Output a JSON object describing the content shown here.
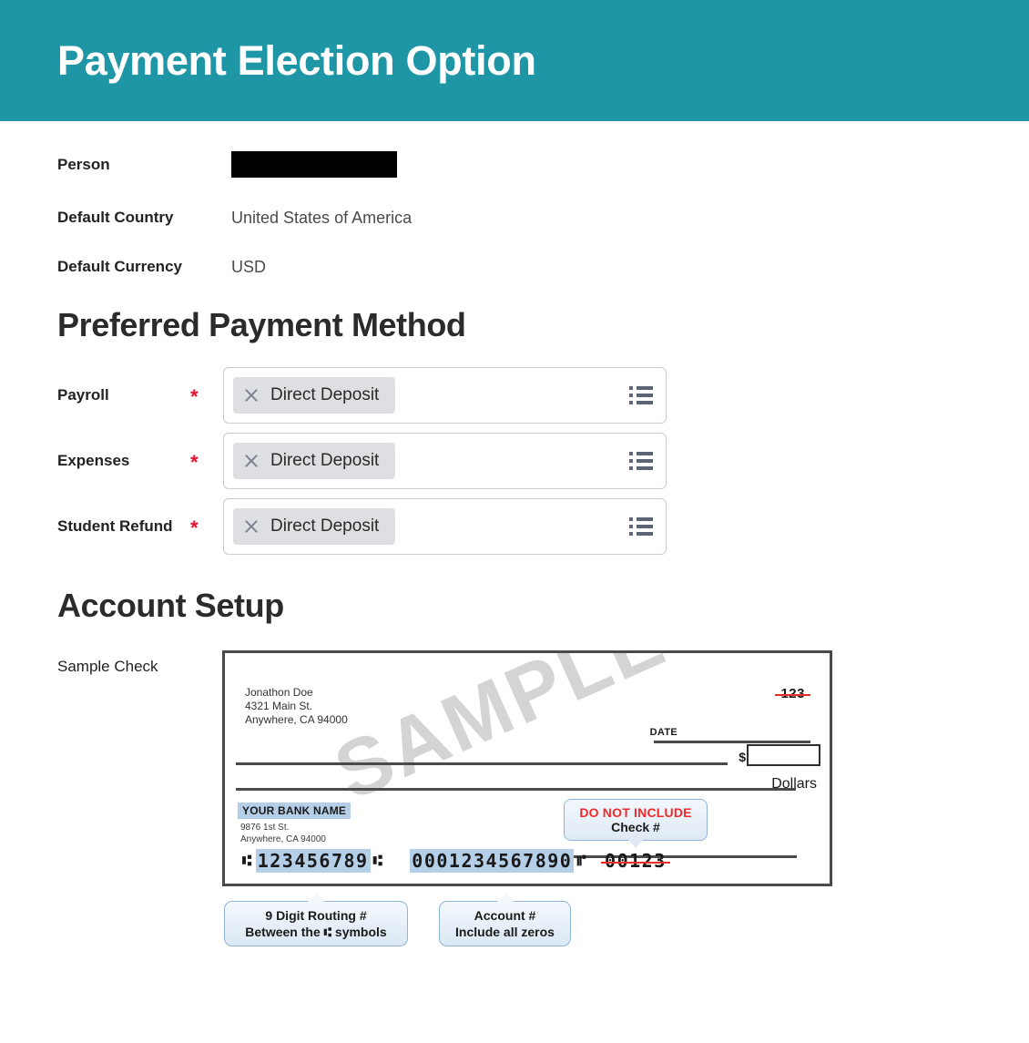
{
  "header": {
    "title": "Payment Election Option",
    "background_color": "#1f96a6"
  },
  "info": {
    "rows": [
      {
        "label": "Person",
        "value": "",
        "redacted": true
      },
      {
        "label": "Default Country",
        "value": "United States of America",
        "redacted": false
      },
      {
        "label": "Default Currency",
        "value": "USD",
        "redacted": false
      }
    ]
  },
  "preferred_payment_method": {
    "heading": "Preferred Payment Method",
    "required_marker": "*",
    "required_color": "#e8112d",
    "rows": [
      {
        "label": "Payroll",
        "value": "Direct Deposit",
        "remove_icon": "close-icon",
        "prompt_icon": "list-prompt-icon"
      },
      {
        "label": "Expenses",
        "value": "Direct Deposit",
        "remove_icon": "close-icon",
        "prompt_icon": "list-prompt-icon"
      },
      {
        "label": "Student Refund",
        "value": "Direct Deposit",
        "remove_icon": "close-icon",
        "prompt_icon": "list-prompt-icon"
      }
    ]
  },
  "account_setup": {
    "heading": "Account Setup",
    "sample_check_label": "Sample Check",
    "check": {
      "watermark": "SAMPLE",
      "payer_name": "Jonathon Doe",
      "payer_street": "4321 Main St.",
      "payer_city": "Anywhere, CA 94000",
      "check_number": "123",
      "date_label": "DATE",
      "dollar_sign": "$",
      "dollars_label": "Dollars",
      "bank_name": "YOUR BANK NAME",
      "bank_street": "9876 1st St.",
      "bank_city": "Anywhere, CA 94000",
      "check_callout_line1": "DO NOT INCLUDE",
      "check_callout_line2": "Check #",
      "micr_routing": "123456789",
      "micr_account": "0001234567890",
      "micr_check_number": "00123",
      "micr_symbol": "⑆",
      "micr_onus_symbol": "⑈",
      "routing_callout_line1": "9 Digit  Routing #",
      "routing_callout_line2": "Between the ⑆ symbols",
      "account_callout_line1": "Account #",
      "account_callout_line2": "Include all zeros"
    }
  }
}
